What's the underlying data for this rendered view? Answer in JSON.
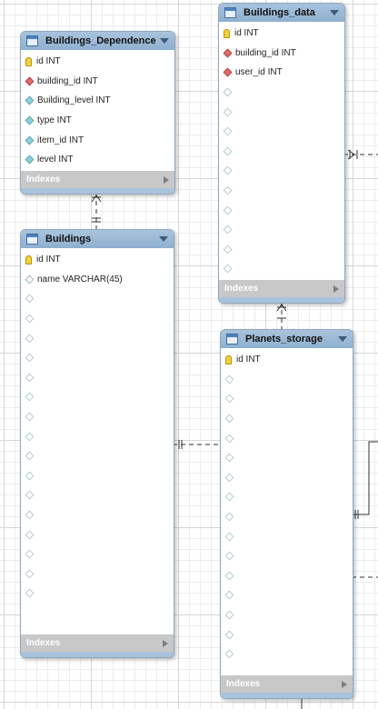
{
  "tables": [
    {
      "name": "Buildings_Dependence",
      "columns": [
        {
          "marker": "key",
          "label": "id INT"
        },
        {
          "marker": "fk",
          "label": "building_id INT"
        },
        {
          "marker": "nn",
          "label": "Building_level INT"
        },
        {
          "marker": "nn",
          "label": "type INT"
        },
        {
          "marker": "nn",
          "label": "item_id INT"
        },
        {
          "marker": "nn",
          "label": "level INT"
        }
      ],
      "footer": "Indexes"
    },
    {
      "name": "Buildings_data",
      "columns": [
        {
          "marker": "key",
          "label": "id INT"
        },
        {
          "marker": "fk",
          "label": "building_id INT"
        },
        {
          "marker": "fk",
          "label": "user_id INT"
        },
        {
          "marker": "empty",
          "label": ""
        },
        {
          "marker": "empty",
          "label": ""
        },
        {
          "marker": "empty",
          "label": ""
        },
        {
          "marker": "empty",
          "label": ""
        },
        {
          "marker": "empty",
          "label": ""
        },
        {
          "marker": "empty",
          "label": ""
        },
        {
          "marker": "empty",
          "label": ""
        },
        {
          "marker": "empty",
          "label": ""
        },
        {
          "marker": "empty",
          "label": ""
        },
        {
          "marker": "empty",
          "label": ""
        }
      ],
      "footer": "Indexes"
    },
    {
      "name": "Buildings",
      "columns": [
        {
          "marker": "key",
          "label": "id INT"
        },
        {
          "marker": "col",
          "label": "name VARCHAR(45)"
        },
        {
          "marker": "empty",
          "label": ""
        },
        {
          "marker": "empty",
          "label": ""
        },
        {
          "marker": "empty",
          "label": ""
        },
        {
          "marker": "empty",
          "label": ""
        },
        {
          "marker": "empty",
          "label": ""
        },
        {
          "marker": "empty",
          "label": ""
        },
        {
          "marker": "empty",
          "label": ""
        },
        {
          "marker": "empty",
          "label": ""
        },
        {
          "marker": "empty",
          "label": ""
        },
        {
          "marker": "empty",
          "label": ""
        },
        {
          "marker": "empty",
          "label": ""
        },
        {
          "marker": "empty",
          "label": ""
        },
        {
          "marker": "empty",
          "label": ""
        },
        {
          "marker": "empty",
          "label": ""
        },
        {
          "marker": "empty",
          "label": ""
        },
        {
          "marker": "empty",
          "label": ""
        }
      ],
      "footer": "Indexes"
    },
    {
      "name": "Planets_storage",
      "columns": [
        {
          "marker": "key",
          "label": "id INT"
        },
        {
          "marker": "empty",
          "label": ""
        },
        {
          "marker": "empty",
          "label": ""
        },
        {
          "marker": "empty",
          "label": ""
        },
        {
          "marker": "empty",
          "label": ""
        },
        {
          "marker": "empty",
          "label": ""
        },
        {
          "marker": "empty",
          "label": ""
        },
        {
          "marker": "empty",
          "label": ""
        },
        {
          "marker": "empty",
          "label": ""
        },
        {
          "marker": "empty",
          "label": ""
        },
        {
          "marker": "empty",
          "label": ""
        },
        {
          "marker": "empty",
          "label": ""
        },
        {
          "marker": "empty",
          "label": ""
        },
        {
          "marker": "empty",
          "label": ""
        },
        {
          "marker": "empty",
          "label": ""
        },
        {
          "marker": "empty",
          "label": ""
        }
      ],
      "footer": "Indexes"
    }
  ],
  "colors": {
    "header": "#99b9d8",
    "canvas_grid": "#d6d6d6",
    "footer": "#c8c8c8",
    "relationship_line": "#333333"
  }
}
